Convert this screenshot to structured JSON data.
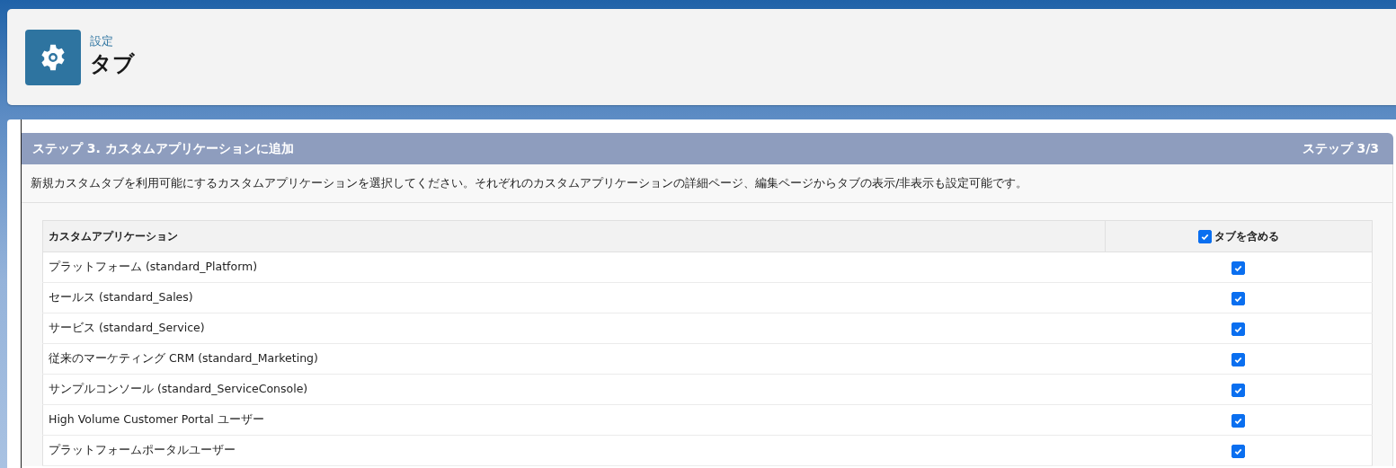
{
  "header": {
    "breadcrumb": "設定",
    "title": "タブ"
  },
  "step": {
    "title": "ステップ 3. カスタムアプリケーションに追加",
    "counter": "ステップ 3/3",
    "description": "新規カスタムタブを利用可能にするカスタムアプリケーションを選択してください。それぞれのカスタムアプリケーションの詳細ページ、編集ページからタブの表示/非表示も設定可能です。"
  },
  "table": {
    "columns": [
      {
        "label": "カスタムアプリケーション"
      },
      {
        "label": "タブを含める",
        "checked": true
      }
    ],
    "rows": [
      {
        "name": "プラットフォーム (standard_Platform)",
        "checked": true
      },
      {
        "name": "セールス (standard_Sales)",
        "checked": true
      },
      {
        "name": "サービス (standard_Service)",
        "checked": true
      },
      {
        "name": "従来のマーケティング CRM (standard_Marketing)",
        "checked": true
      },
      {
        "name": "サンプルコンソール (standard_ServiceConsole)",
        "checked": true
      },
      {
        "name": "High Volume Customer Portal ユーザー",
        "checked": true
      },
      {
        "name": "プラットフォームポータルユーザー",
        "checked": true
      }
    ]
  }
}
